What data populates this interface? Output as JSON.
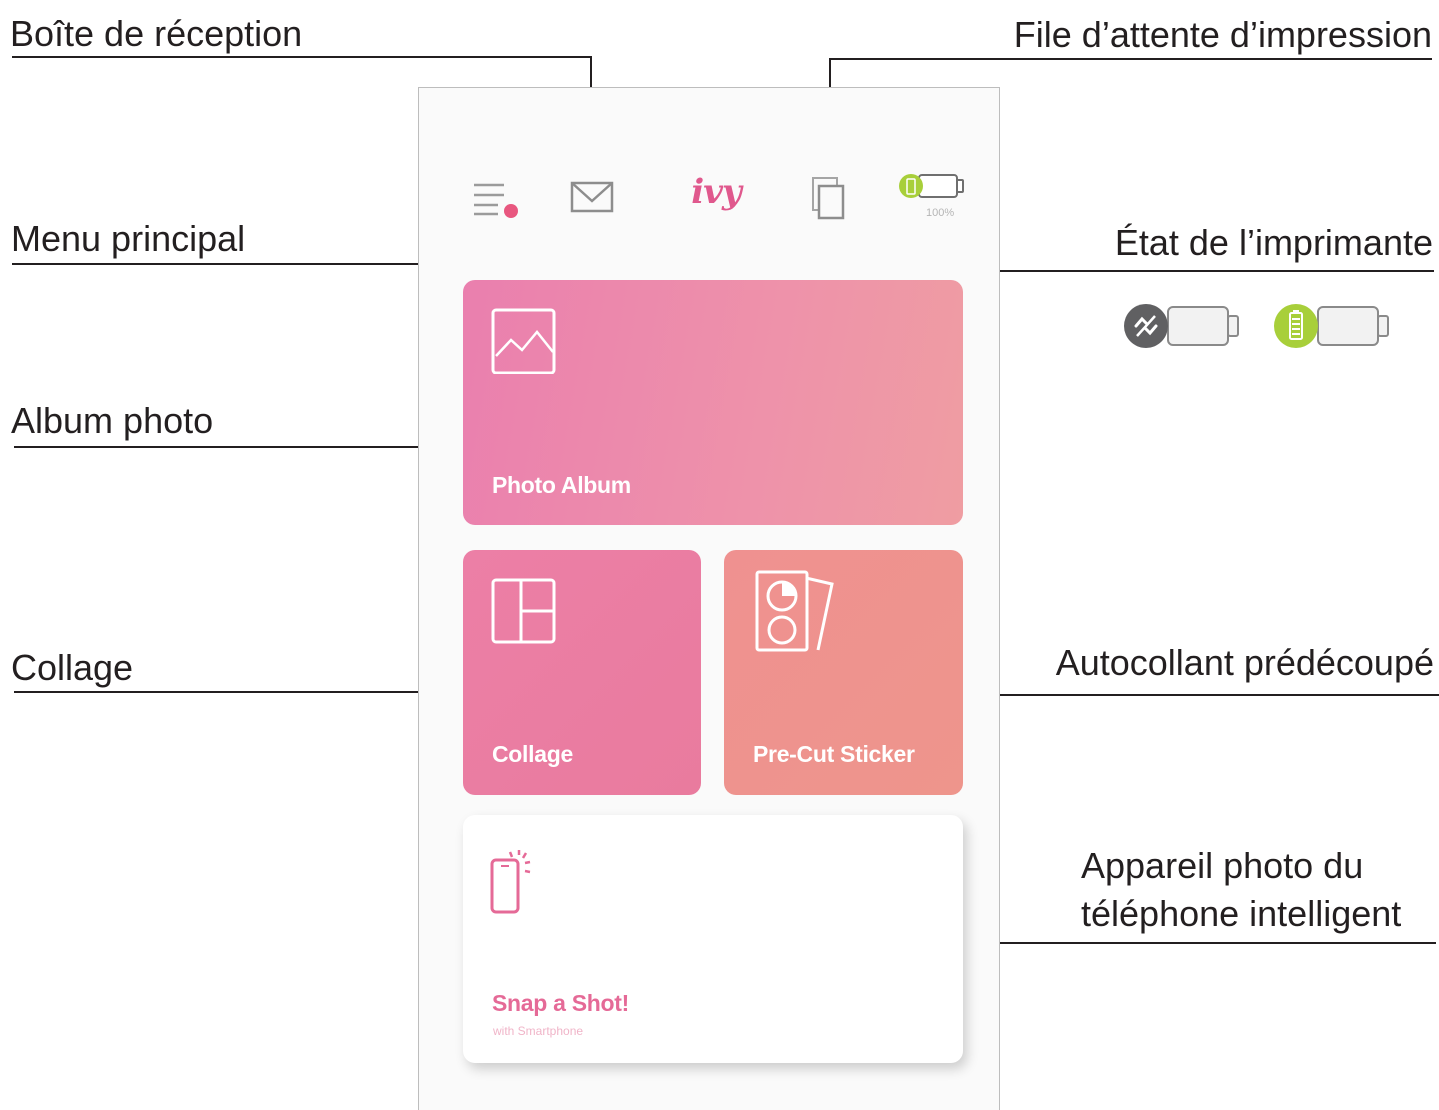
{
  "callouts": {
    "inbox": "Boîte de réception",
    "print_queue": "File d’attente d’impression",
    "main_menu": "Menu principal",
    "printer_status": "État de l’imprimante",
    "photo_album": "Album photo",
    "collage": "Collage",
    "precut_sticker": "Autocollant prédécoupé",
    "smartphone_camera_line1": "Appareil photo du",
    "smartphone_camera_line2": "téléphone intelligent"
  },
  "app": {
    "logo": "ivy",
    "battery_percent": "100%",
    "brand_color": "#e0588d",
    "notification_dot_color": "#e8577f",
    "battery_ok_color": "#9fcf3c"
  },
  "tiles": {
    "photo_album": "Photo Album",
    "collage": "Collage",
    "precut_sticker": "Pre-Cut Sticker",
    "snap_a_shot": "Snap a Shot!",
    "snap_a_shot_sub": "with Smartphone"
  },
  "status_icons": {
    "disconnected": "disconnected-icon",
    "charging": "battery-charging-icon"
  }
}
